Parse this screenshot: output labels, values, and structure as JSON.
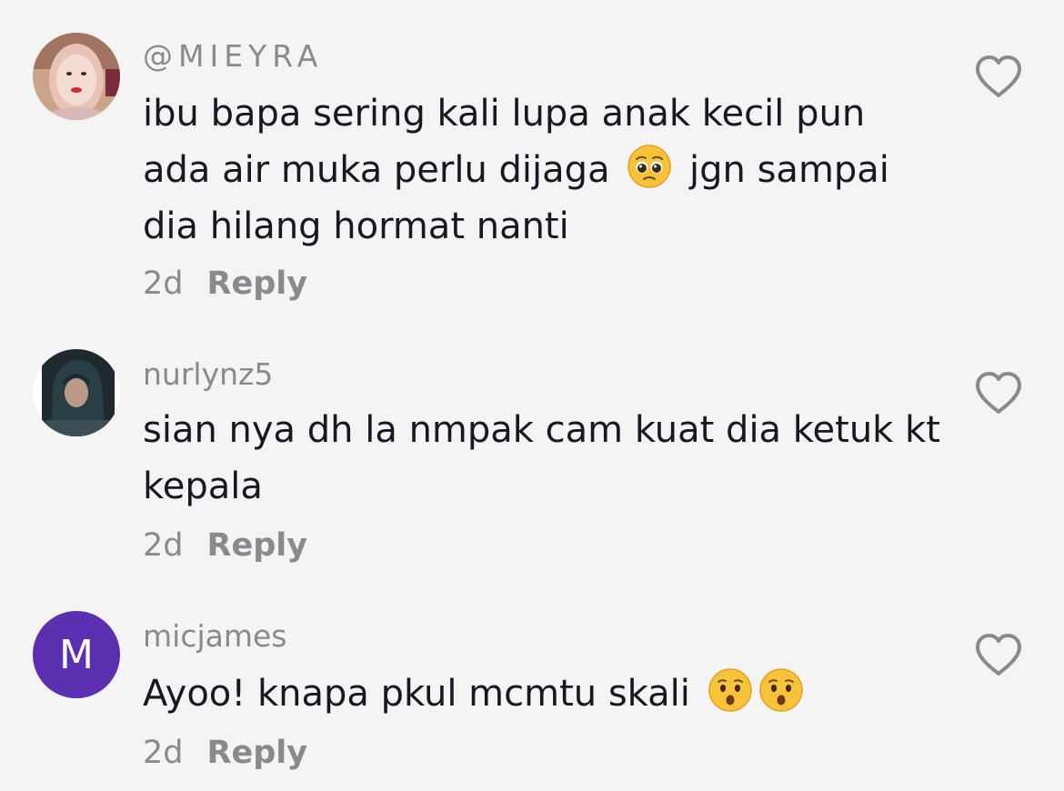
{
  "comments": [
    {
      "username": "@MIEYRA",
      "text_before_emoji": "ibu bapa sering kali lupa anak kecil pun ada air muka perlu dijaga",
      "emoji": "pleading-face-emoji",
      "text_after_emoji": "jgn sampai dia hilang hormat nanti",
      "time": "2d",
      "reply_label": "Reply"
    },
    {
      "username": "nurlynz5",
      "text": "sian nya dh la nmpak cam kuat dia ketuk kt kepala",
      "time": "2d",
      "reply_label": "Reply"
    },
    {
      "username": "micjames",
      "avatar_letter": "M",
      "text": "Ayoo! knapa pkul mcmtu skali",
      "emojis": [
        "hushed-face-emoji",
        "hushed-face-emoji"
      ],
      "time": "2d",
      "reply_label": "Reply"
    }
  ],
  "colors": {
    "background": "#f4f4f4",
    "text": "#161823",
    "secondary": "#8a8a8e",
    "avatar_purple": "#5a2fb0"
  },
  "icons": [
    "heart-outline-icon"
  ]
}
